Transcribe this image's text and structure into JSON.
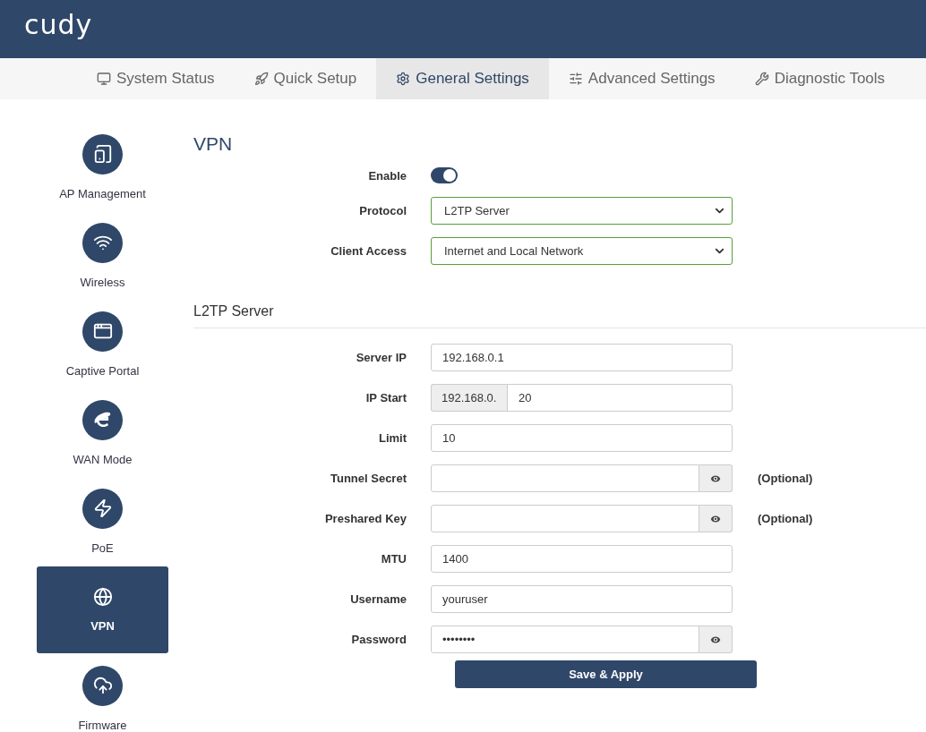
{
  "brand": "cudy",
  "tabs": [
    {
      "label": "System Status",
      "selected": false
    },
    {
      "label": "Quick Setup",
      "selected": false
    },
    {
      "label": "General Settings",
      "selected": true
    },
    {
      "label": "Advanced Settings",
      "selected": false
    },
    {
      "label": "Diagnostic Tools",
      "selected": false
    }
  ],
  "sidebar": {
    "items": [
      {
        "label": "AP Management",
        "selected": false
      },
      {
        "label": "Wireless",
        "selected": false
      },
      {
        "label": "Captive Portal",
        "selected": false
      },
      {
        "label": "WAN Mode",
        "selected": false
      },
      {
        "label": "PoE",
        "selected": false
      },
      {
        "label": "VPN",
        "selected": true
      },
      {
        "label": "Firmware",
        "selected": false
      }
    ]
  },
  "vpn": {
    "title": "VPN",
    "enable": {
      "label": "Enable",
      "on": true
    },
    "protocol": {
      "label": "Protocol",
      "value": "L2TP Server"
    },
    "client_access": {
      "label": "Client Access",
      "value": "Internet and Local Network"
    }
  },
  "l2tp": {
    "title": "L2TP Server",
    "fields": [
      {
        "kind": "text",
        "label": "Server IP",
        "value": "192.168.0.1"
      },
      {
        "kind": "prefixed",
        "label": "IP Start",
        "prefix": "192.168.0.",
        "value": "20"
      },
      {
        "kind": "text",
        "label": "Limit",
        "value": "10"
      },
      {
        "kind": "secret",
        "label": "Tunnel Secret",
        "note": "(Optional)"
      },
      {
        "kind": "secret",
        "label": "Preshared Key",
        "note": "(Optional)"
      },
      {
        "kind": "text",
        "label": "MTU",
        "value": "1400"
      },
      {
        "kind": "text",
        "label": "Username",
        "value": "youruser"
      },
      {
        "kind": "secret",
        "label": "Password",
        "value": "••••••••"
      }
    ],
    "save_button": "Save & Apply"
  }
}
